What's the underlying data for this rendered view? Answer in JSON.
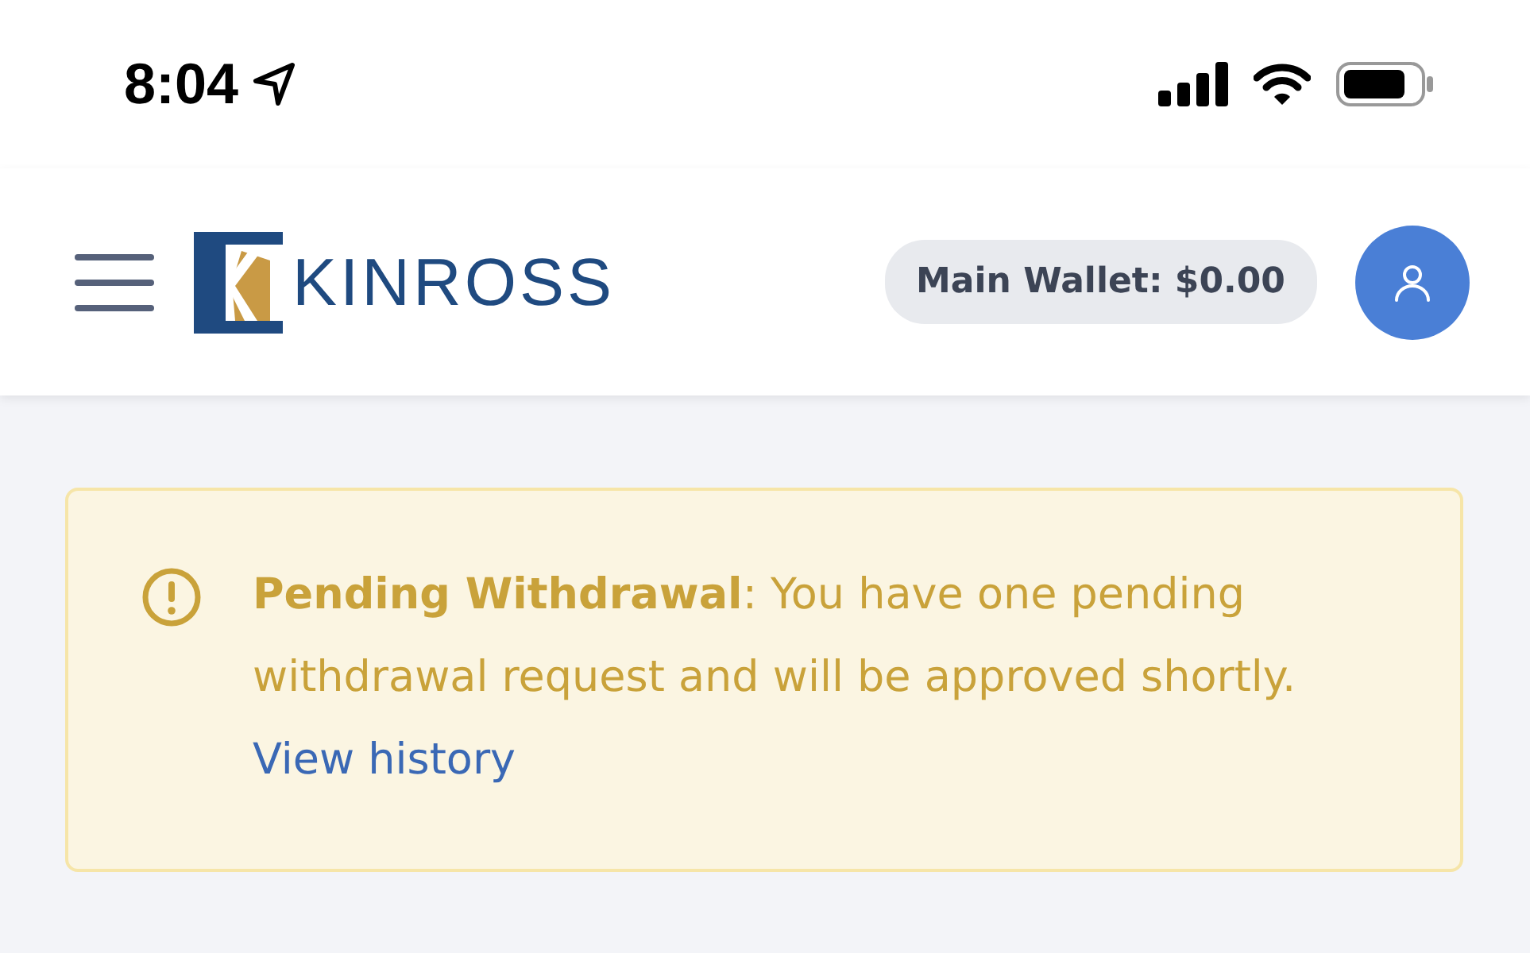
{
  "status_bar": {
    "time": "8:04"
  },
  "header": {
    "brand": "KINROSS",
    "wallet": "Main Wallet: $0.00"
  },
  "alert": {
    "message": "**Pending Withdrawal**: You have one pending withdrawal request and will be approved shortly.",
    "link": "View history"
  }
}
